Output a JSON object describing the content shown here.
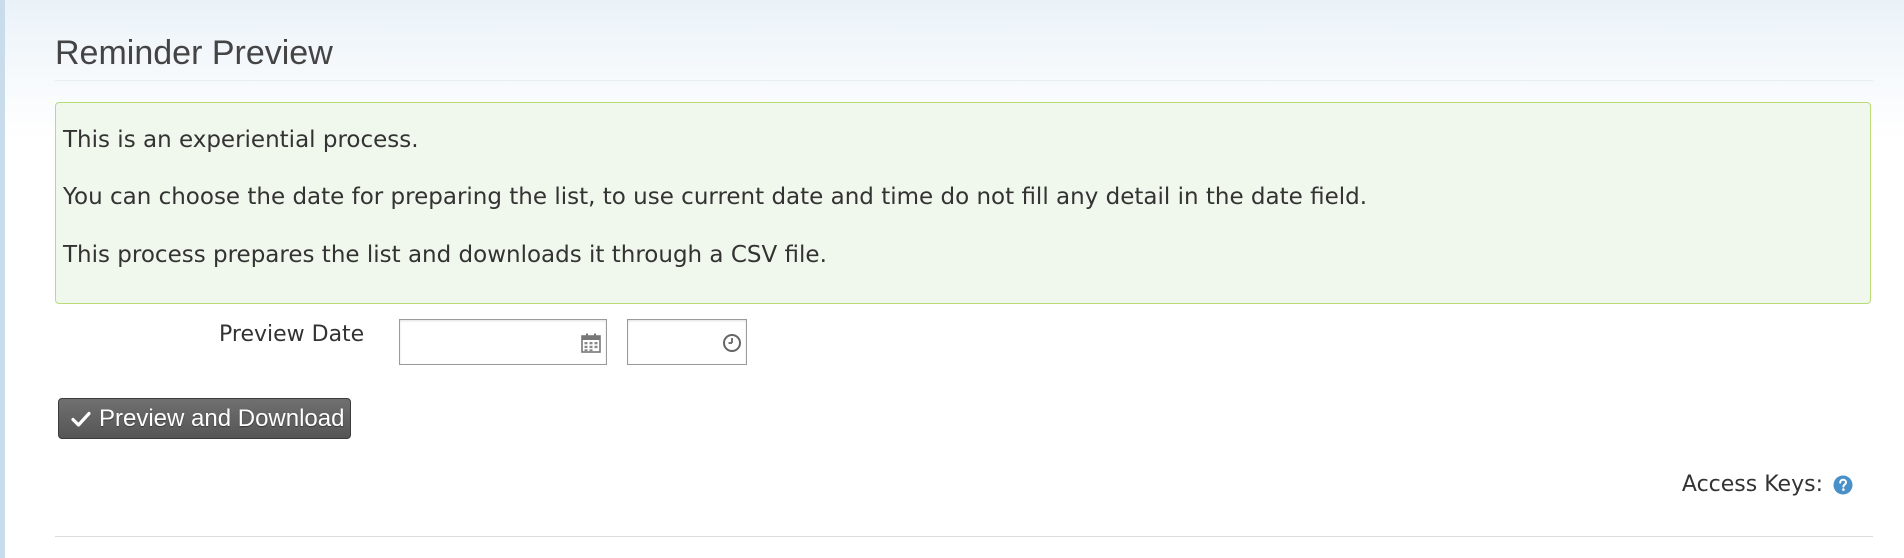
{
  "page": {
    "title": "Reminder Preview"
  },
  "info": {
    "lines": [
      "This is an experiential process.",
      "You can choose the date for preparing the list, to use current date and time do not fill any detail in the date field.",
      "This process prepares the list and downloads it through a CSV file."
    ]
  },
  "form": {
    "preview_date_label": "Preview Date",
    "date_value": "",
    "time_value": "",
    "date_icon": "calendar-icon",
    "time_icon": "clock-icon"
  },
  "actions": {
    "preview_download_label": "Preview and Download",
    "preview_download_icon": "check-icon"
  },
  "footer": {
    "access_keys_label": "Access Keys:",
    "help_icon": "question-circle-icon"
  },
  "colors": {
    "info_bg": "#f0f7ec",
    "info_border": "#b9dc77",
    "button_bg": "#5f5f5f",
    "help_icon": "#4a90c8"
  }
}
